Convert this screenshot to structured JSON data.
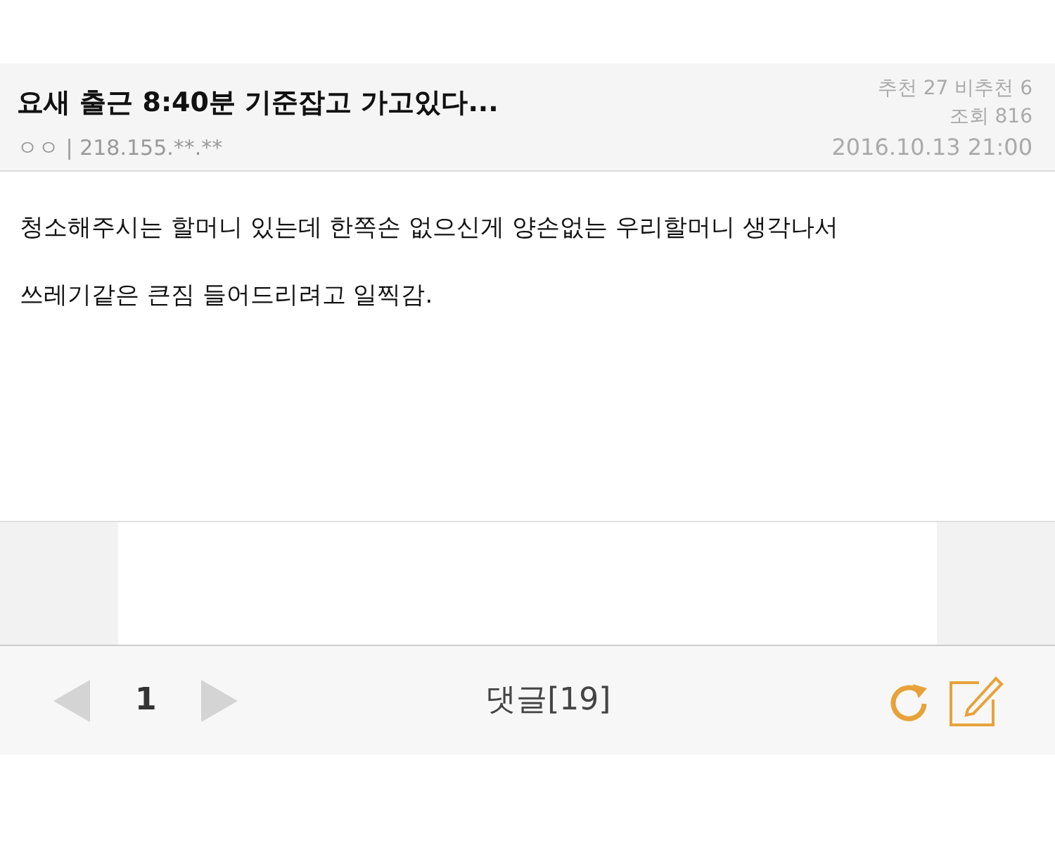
{
  "post": {
    "title": "요새 출근 8:40분 기준잡고 가고있다...",
    "author": "ㅇㅇ | 218.155.**.**",
    "votes": "추천 27 비추천 6",
    "views": "조회 816",
    "date": "2016.10.13 21:00"
  },
  "body": [
    "청소해주시는 할머니 있는데 한쪽손 없으신게 양손없는 우리할머니 생각나서",
    "쓰레기같은 큰짐 들어드리려고 일찍감."
  ],
  "footer": {
    "prev_disabled": true,
    "page": "1",
    "next_disabled": true,
    "comments": "댓글[19]"
  }
}
